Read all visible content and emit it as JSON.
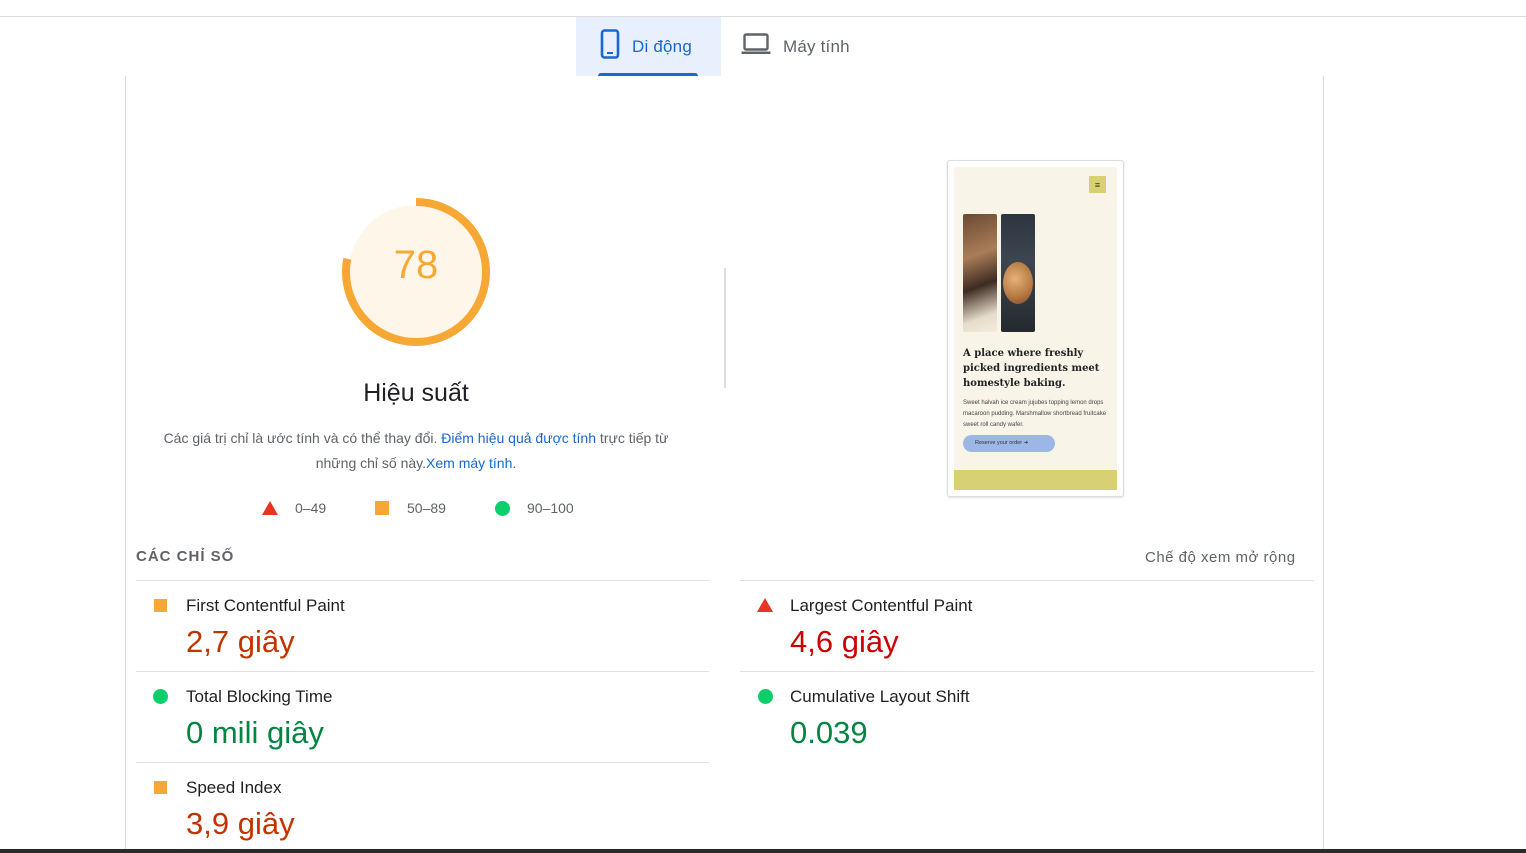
{
  "tabs": {
    "mobile_label": "Di động",
    "desktop_label": "Máy tính"
  },
  "score": {
    "value": "78",
    "fraction": 0.78,
    "title": "Hiệu suất",
    "description_prefix": "Các giá trị chỉ là ước tính và có thể thay đổi. ",
    "description_link": "Điểm hiệu quả được tính",
    "description_suffix": " trực tiếp từ những chỉ số này.",
    "calculator_link": "Xem máy tính."
  },
  "legend": {
    "fail": "0–49",
    "average": "50–89",
    "pass": "90–100"
  },
  "preview": {
    "headline": "A place where freshly picked ingredients meet homestyle baking.",
    "body": "Sweet halvah ice cream jujubes topping lemon drops macaroon pudding. Marshmallow shortbread fruitcake sweet roll candy wafer.",
    "button": "Reserve your order  ➜"
  },
  "metrics": {
    "heading": "CÁC CHỈ SỐ",
    "expand_view": "Chế độ xem mở rộng",
    "fcp": {
      "name": "First Contentful Paint",
      "value": "2,7 giây"
    },
    "lcp": {
      "name": "Largest Contentful Paint",
      "value": "4,6 giây"
    },
    "tbt": {
      "name": "Total Blocking Time",
      "value": "0 mili giây"
    },
    "cls": {
      "name": "Cumulative Layout Shift",
      "value": "0.039"
    },
    "si": {
      "name": "Speed Index",
      "value": "3,9 giây"
    }
  },
  "colors": {
    "accent": "#1967d2",
    "average": "#f7a834",
    "fail": "#eb3323",
    "pass": "#0cce6b"
  }
}
